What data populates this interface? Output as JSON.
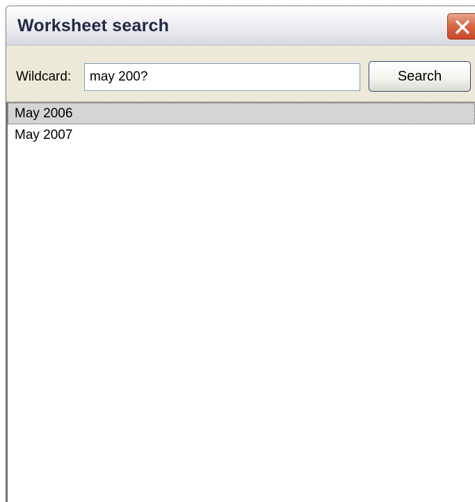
{
  "window": {
    "title": "Worksheet search"
  },
  "toolbar": {
    "wildcard_label": "Wildcard:",
    "wildcard_value": "may 200?",
    "search_label": "Search"
  },
  "results": {
    "items": [
      "May 2006",
      "May 2007"
    ],
    "selected_index": 0
  },
  "icons": {
    "close": "close-icon"
  },
  "colors": {
    "title_text": "#222a44",
    "close_button": "#d86a48",
    "selection": "#d4d4d4",
    "input_border": "#7f9db9"
  }
}
